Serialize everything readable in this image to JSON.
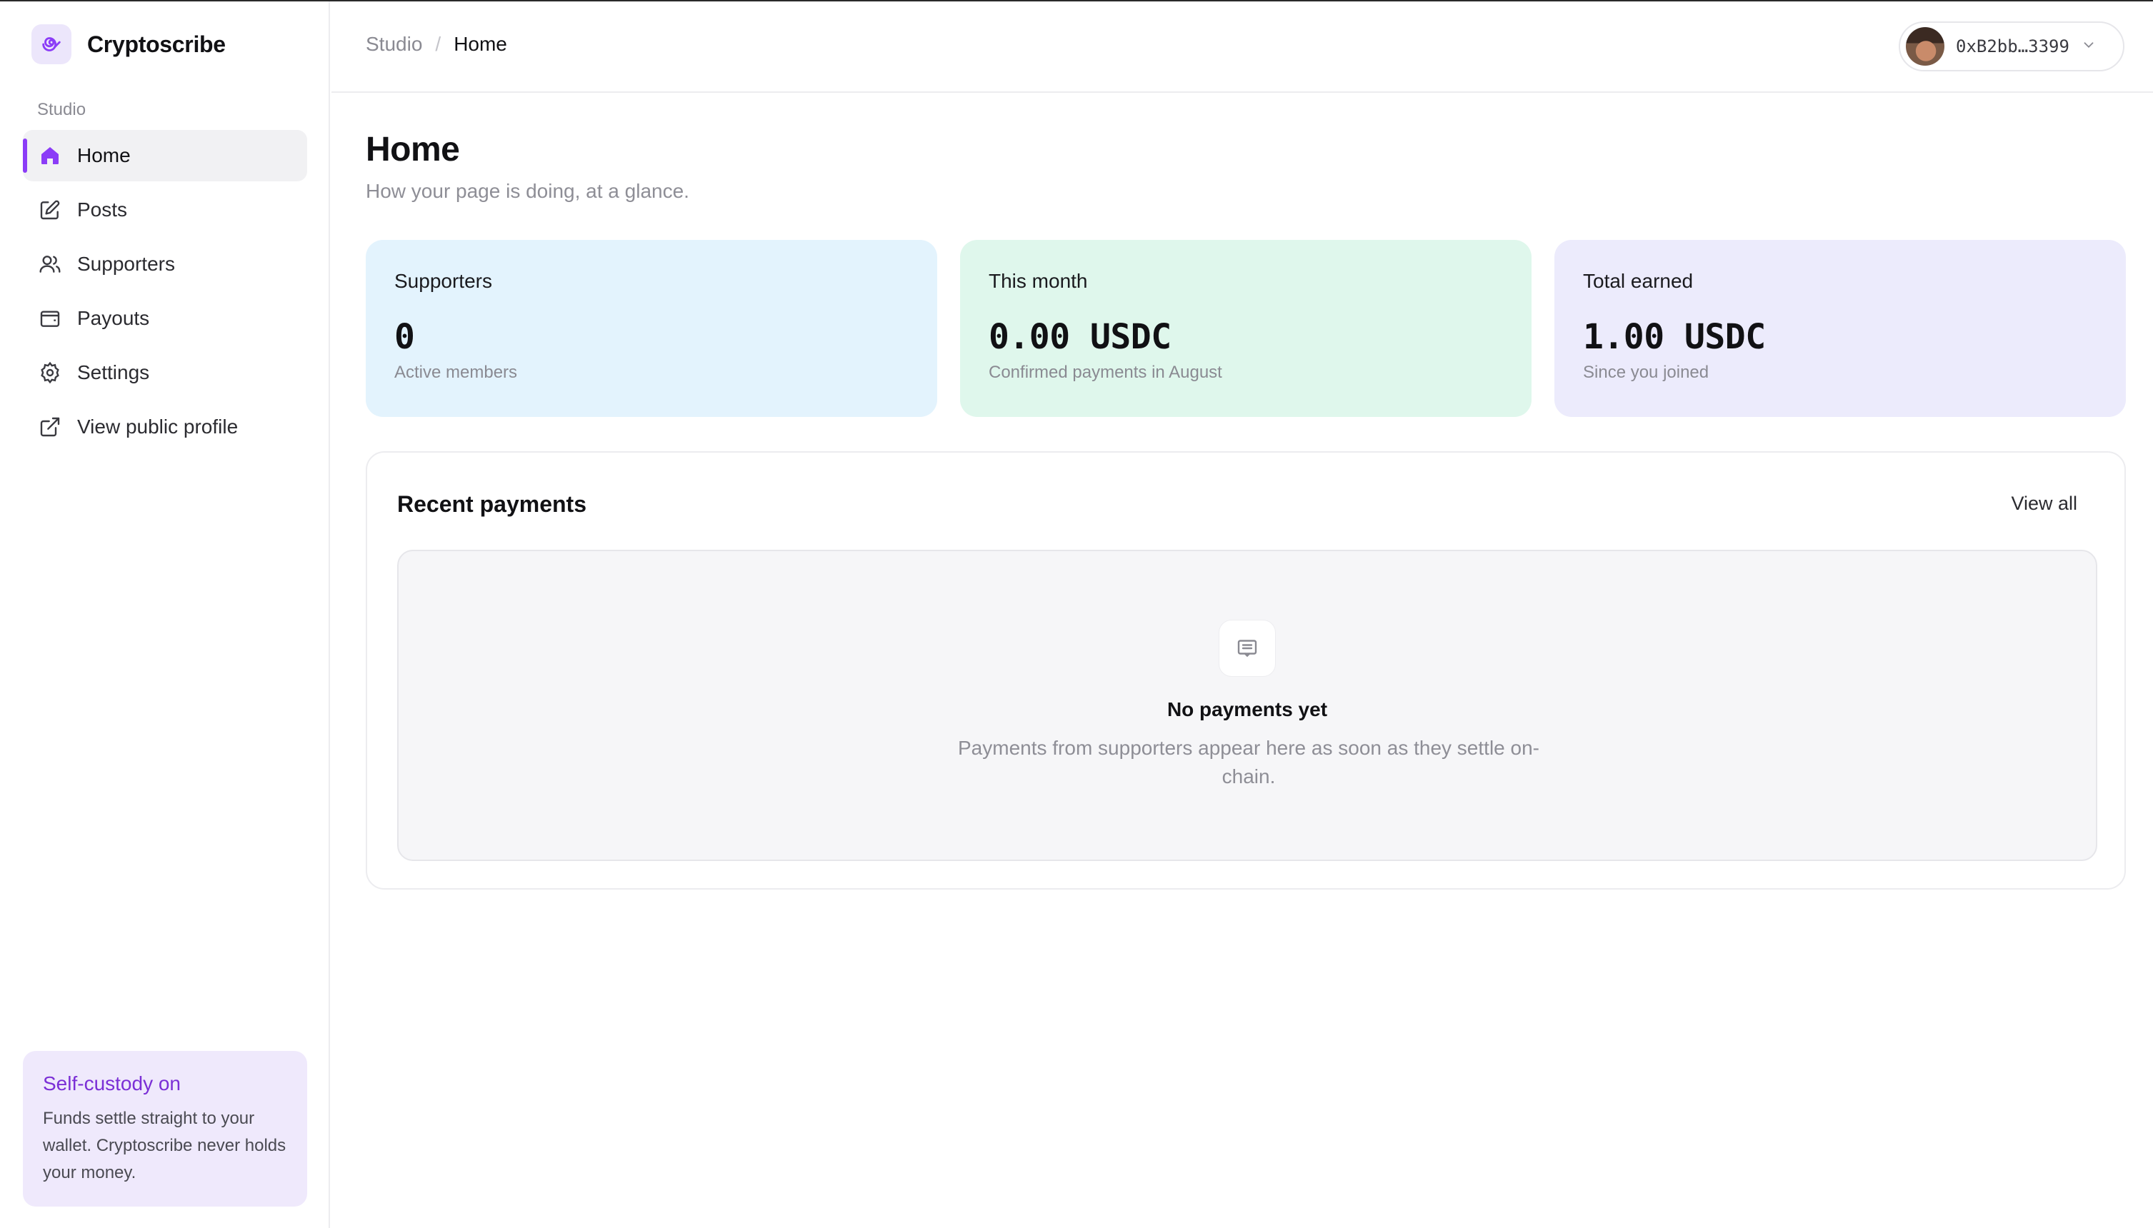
{
  "brand": {
    "name": "Cryptoscribe",
    "logo_icon": "spiral-logo-icon",
    "accent": "#8b3cf7"
  },
  "sidebar": {
    "section_label": "Studio",
    "items": [
      {
        "label": "Home",
        "icon": "home-icon",
        "active": true
      },
      {
        "label": "Posts",
        "icon": "edit-icon"
      },
      {
        "label": "Supporters",
        "icon": "users-icon"
      },
      {
        "label": "Payouts",
        "icon": "wallet-icon"
      },
      {
        "label": "Settings",
        "icon": "gear-icon"
      },
      {
        "label": "View public profile",
        "icon": "external-link-icon"
      }
    ],
    "custody": {
      "title": "Self-custody on",
      "text": "Funds settle straight to your wallet. Cryptoscribe never holds your money."
    }
  },
  "header": {
    "breadcrumb": {
      "root": "Studio",
      "separator": "/",
      "current": "Home"
    },
    "wallet": {
      "address": "0xB2bb…3399"
    }
  },
  "page": {
    "title": "Home",
    "subtitle": "How your page is doing, at a glance."
  },
  "stats": [
    {
      "label": "Supporters",
      "value": "0",
      "caption": "Active members",
      "color": "#e3f3fd"
    },
    {
      "label": "This month",
      "value": "0.00 USDC",
      "caption": "Confirmed payments in August",
      "color": "#dff7ec"
    },
    {
      "label": "Total earned",
      "value": "1.00 USDC",
      "caption": "Since you joined",
      "color": "#ecebfc"
    }
  ],
  "payments": {
    "title": "Recent payments",
    "view_all": "View all",
    "empty": {
      "icon": "receipt-icon",
      "title": "No payments yet",
      "text": "Payments from supporters appear here as soon as they settle on-chain."
    }
  }
}
